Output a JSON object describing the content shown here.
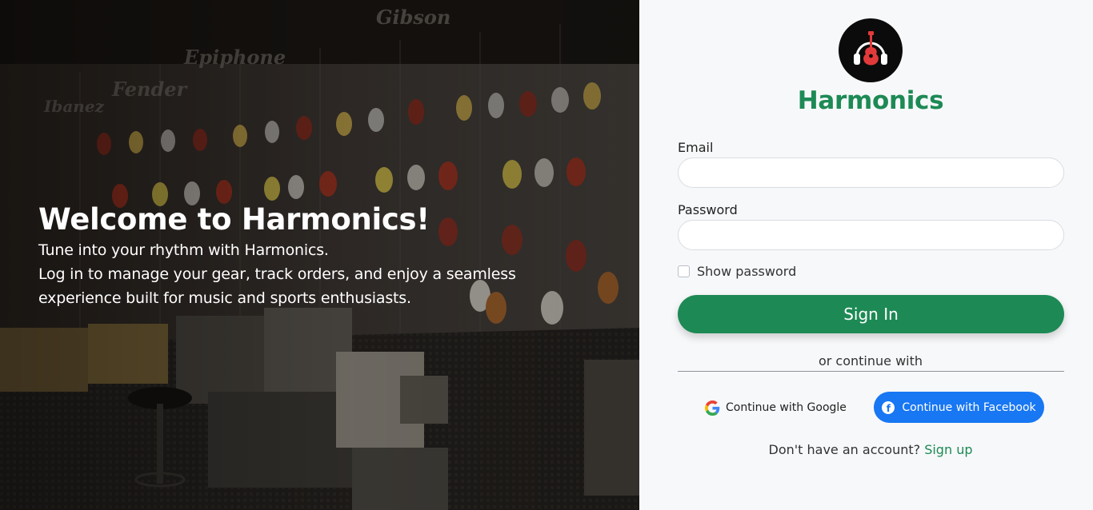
{
  "hero": {
    "title": "Welcome to Harmonics!",
    "line1": "Tune into your rhythm with Harmonics.",
    "line2": "Log in to manage your gear, track orders, and enjoy a seamless",
    "line3": "experience built for music and sports enthusiasts.",
    "background_image": "guitar-store-photo",
    "store_signs": [
      "Epiphone",
      "Fender",
      "Ibanez",
      "Gibson"
    ]
  },
  "logo": {
    "icon": "guitar-headphones-icon"
  },
  "brand": {
    "name": "Harmonics",
    "color": "#1d8a55"
  },
  "form": {
    "email_label": "Email",
    "email_value": "",
    "email_placeholder": "",
    "password_label": "Password",
    "password_value": "",
    "password_placeholder": "",
    "show_password_label": "Show password",
    "show_password_checked": false,
    "signin_label": "Sign In"
  },
  "social": {
    "divider_text": "or continue with",
    "google_label": "Continue with Google",
    "facebook_label": "Continue with Facebook",
    "facebook_color": "#1877f2"
  },
  "signup": {
    "prompt": "Don't have an account?",
    "link_label": "Sign up"
  }
}
